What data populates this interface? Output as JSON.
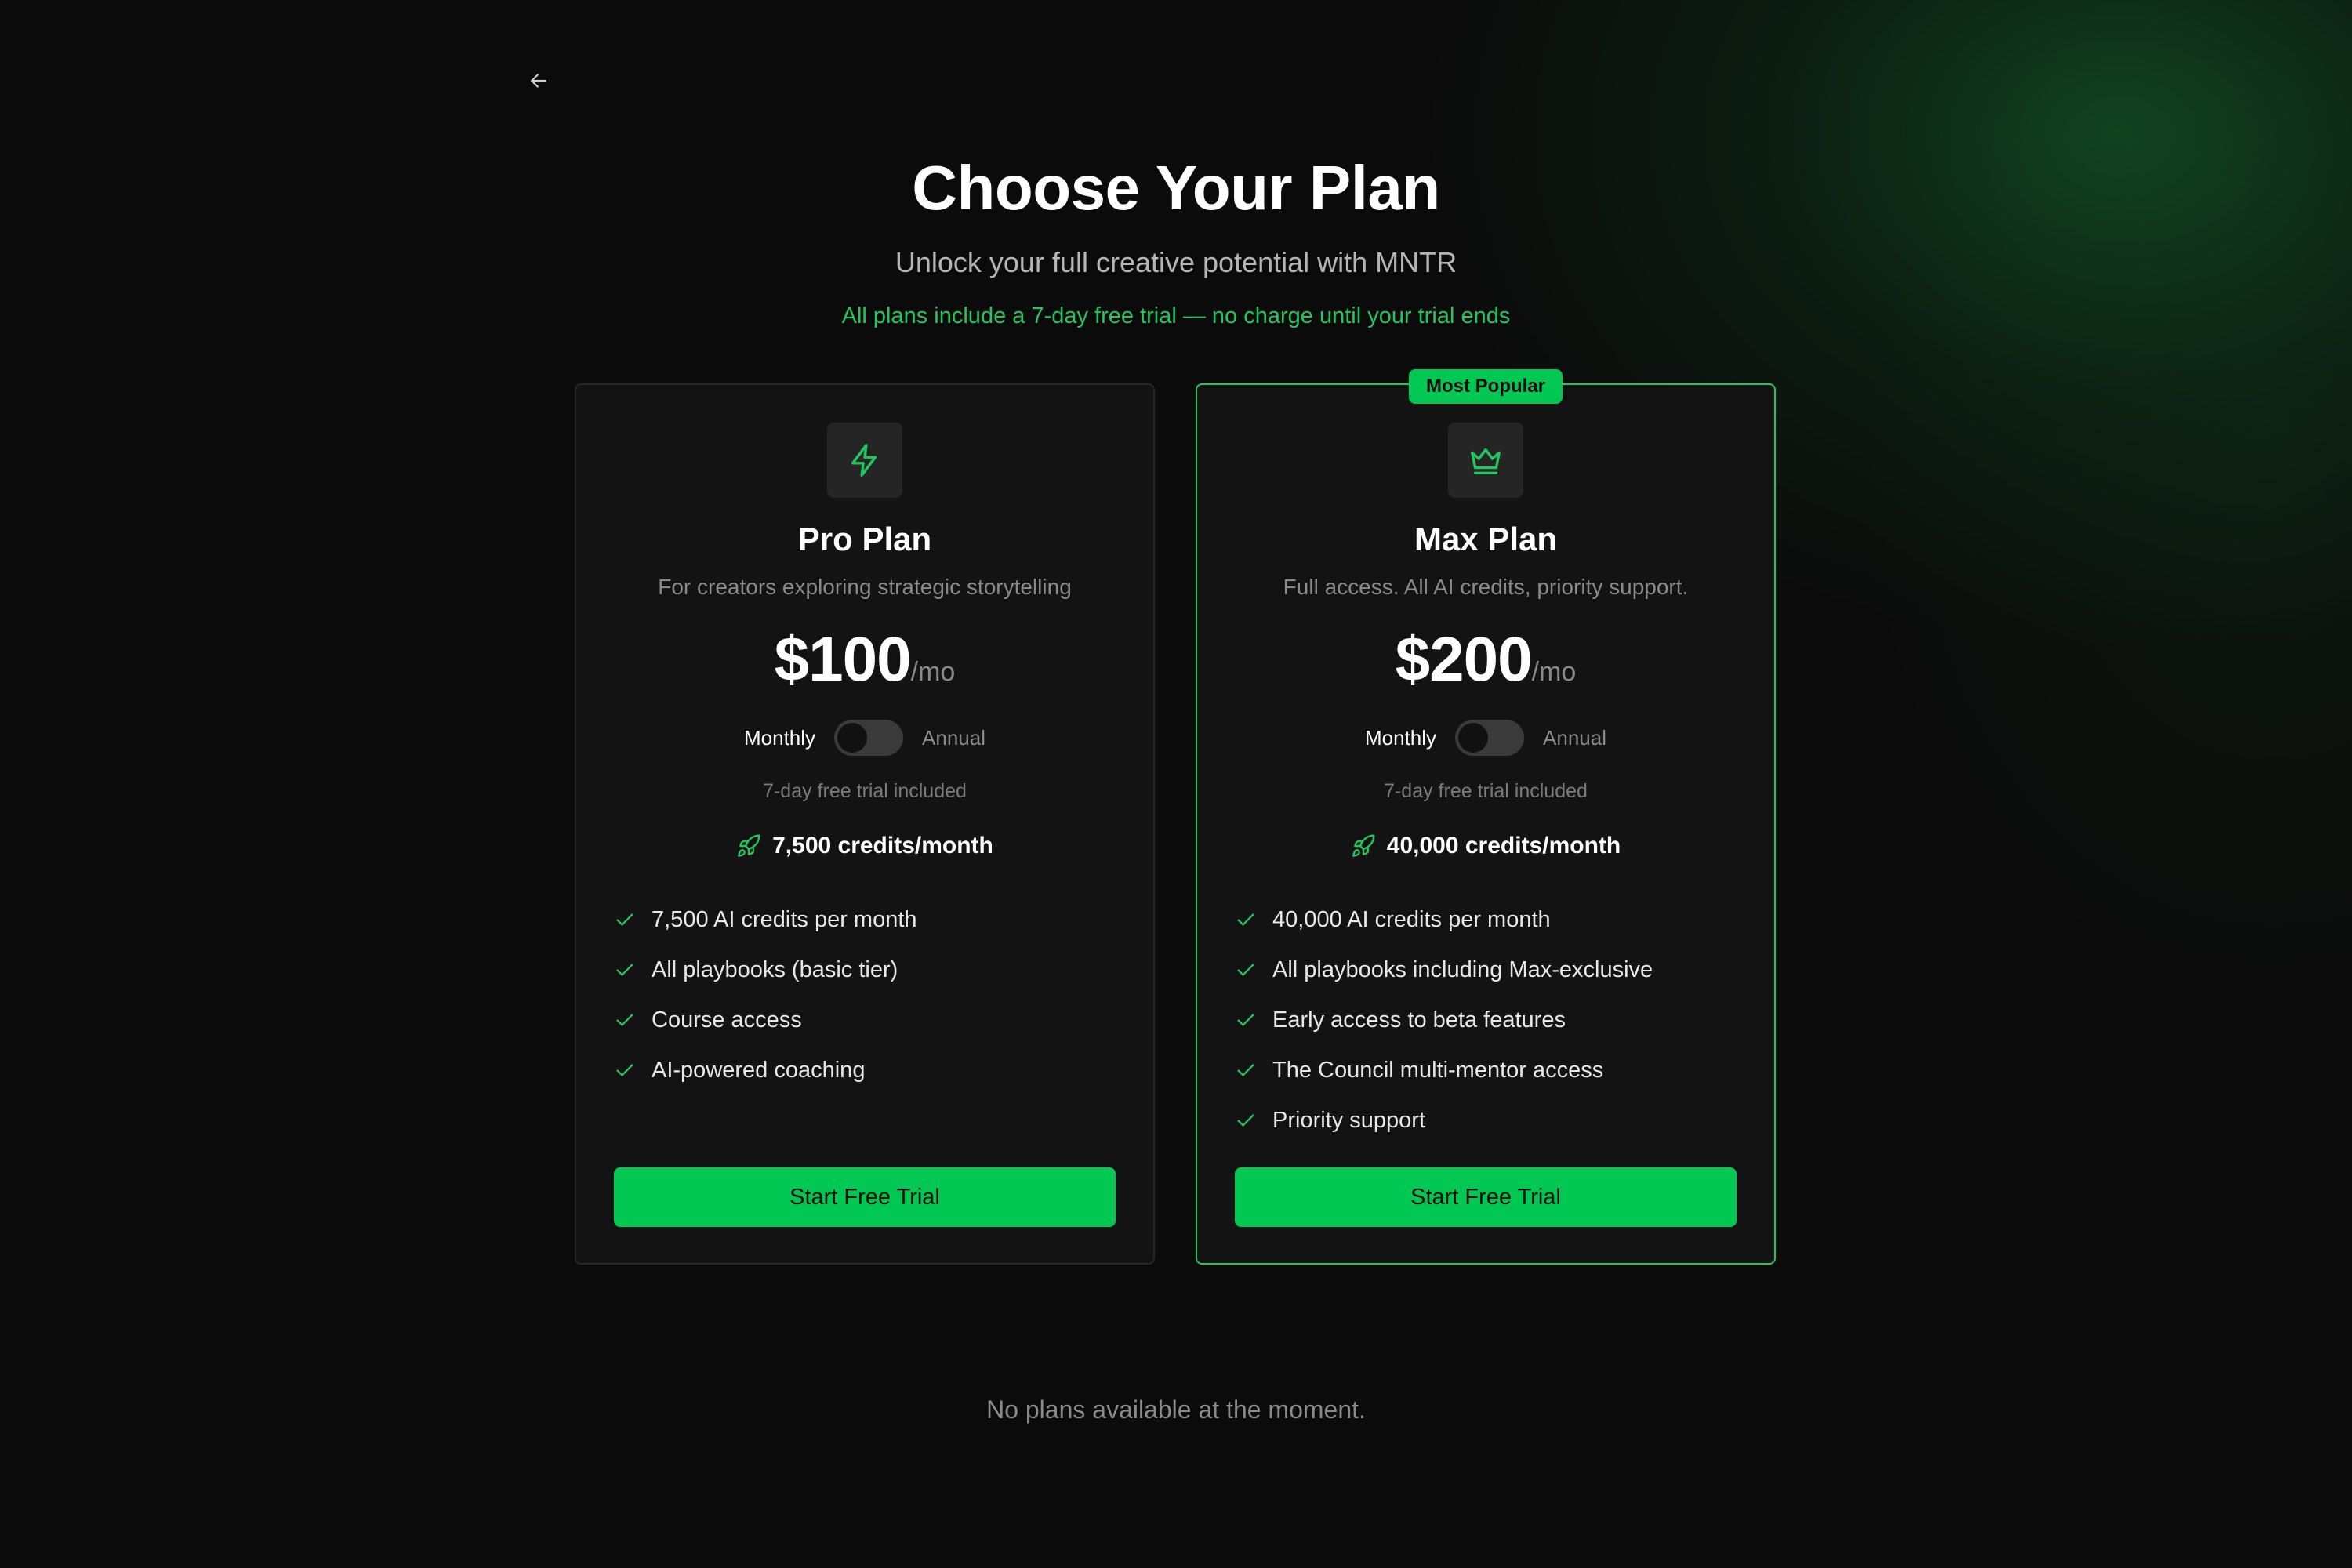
{
  "header": {
    "title": "Choose Your Plan",
    "subtitle": "Unlock your full creative potential with MNTR",
    "trial_notice": "All plans include a 7-day free trial — no charge until your trial ends"
  },
  "plans": [
    {
      "name": "Pro Plan",
      "icon": "lightning-icon",
      "description": "For creators exploring strategic storytelling",
      "price": "$100",
      "price_unit": "/mo",
      "toggle": {
        "left": "Monthly",
        "right": "Annual",
        "selected": "Monthly"
      },
      "trial_text": "7-day free trial included",
      "credits": "7,500 credits/month",
      "features": [
        "7,500 AI credits per month",
        "All playbooks (basic tier)",
        "Course access",
        "AI-powered coaching"
      ],
      "cta": "Start Free Trial"
    },
    {
      "name": "Max Plan",
      "badge": "Most Popular",
      "icon": "crown-icon",
      "description": "Full access. All AI credits, priority support.",
      "price": "$200",
      "price_unit": "/mo",
      "toggle": {
        "left": "Monthly",
        "right": "Annual",
        "selected": "Monthly"
      },
      "trial_text": "7-day free trial included",
      "credits": "40,000 credits/month",
      "features": [
        "40,000 AI credits per month",
        "All playbooks including Max-exclusive",
        "Early access to beta features",
        "The Council multi-mentor access",
        "Priority support"
      ],
      "cta": "Start Free Trial"
    }
  ],
  "empty_state": "No plans available at the moment.",
  "colors": {
    "background": "#0b0b0b",
    "accent": "#22c55e",
    "button": "#00c853",
    "card": "#131313"
  }
}
